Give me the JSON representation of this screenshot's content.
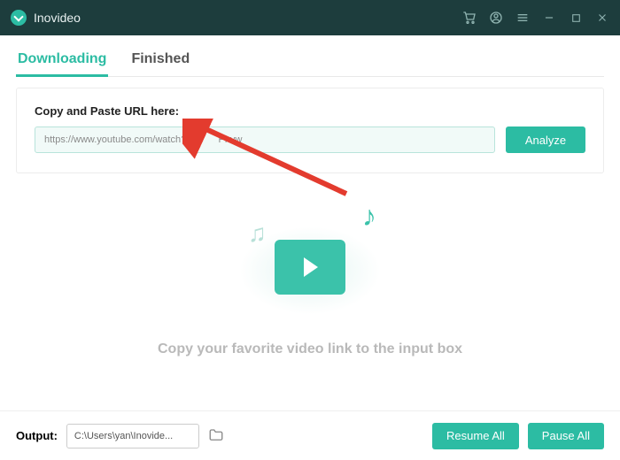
{
  "app": {
    "title": "Inovideo"
  },
  "tabs": {
    "downloading": "Downloading",
    "finished": "Finished"
  },
  "url_card": {
    "label": "Copy and Paste URL here:",
    "input_value": "https://www.youtube.com/watch?v=        Pnvw",
    "analyze": "Analyze"
  },
  "placeholder": {
    "message": "Copy your favorite video link to the input box"
  },
  "footer": {
    "output_label": "Output:",
    "output_path": "C:\\Users\\yan\\Inovide...",
    "resume": "Resume All",
    "pause": "Pause All"
  },
  "colors": {
    "accent": "#2cbca3",
    "titlebar": "#1d3d3d"
  }
}
